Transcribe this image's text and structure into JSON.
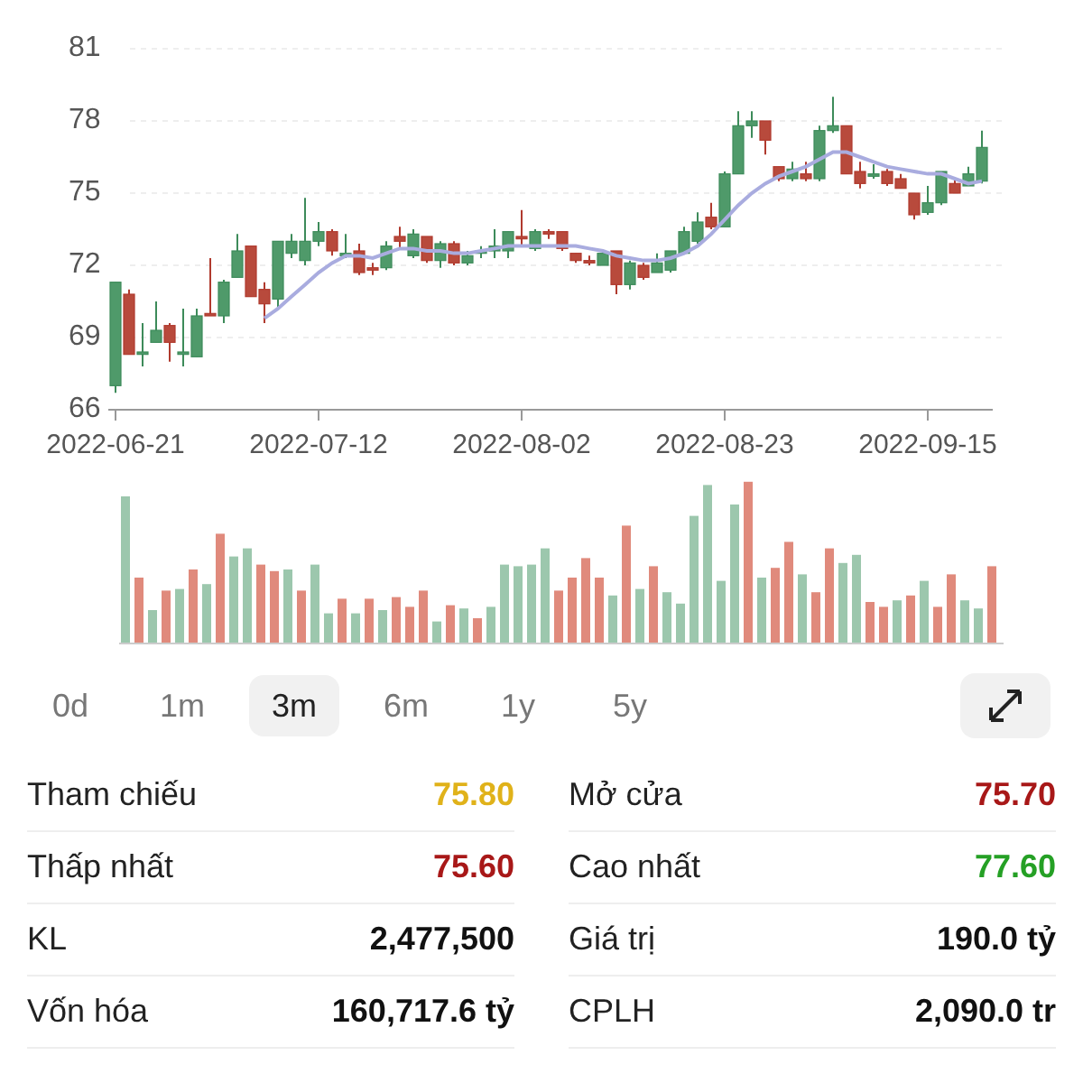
{
  "price_chart": {
    "chart_data": {
      "type": "candlestick",
      "ylim": [
        66,
        81
      ],
      "yticks": [
        81,
        78,
        75,
        72,
        69,
        66
      ],
      "grid": true,
      "categories": [
        "2022-06-21",
        null,
        null,
        null,
        null,
        null,
        null,
        null,
        null,
        null,
        null,
        null,
        null,
        null,
        null,
        "2022-07-12",
        null,
        null,
        null,
        null,
        null,
        null,
        null,
        null,
        null,
        null,
        null,
        null,
        null,
        null,
        "2022-08-02",
        null,
        null,
        null,
        null,
        null,
        null,
        null,
        null,
        null,
        null,
        null,
        null,
        null,
        null,
        "2022-08-23",
        null,
        null,
        null,
        null,
        null,
        null,
        null,
        null,
        null,
        null,
        null,
        null,
        null,
        null,
        "2022-09-15",
        null,
        null,
        null,
        null
      ],
      "ohlc": [
        [
          67,
          71.3,
          66.7,
          71.3
        ],
        [
          70.8,
          71,
          68.3,
          68.3
        ],
        [
          68.3,
          69.6,
          67.8,
          68.4
        ],
        [
          68.8,
          70.5,
          68.8,
          69.3
        ],
        [
          69.5,
          69.6,
          68,
          68.8
        ],
        [
          68.3,
          70.2,
          67.8,
          68.4
        ],
        [
          68.2,
          70.2,
          68.2,
          69.9
        ],
        [
          70,
          72.3,
          69.9,
          69.9
        ],
        [
          69.9,
          71.4,
          69.6,
          71.3
        ],
        [
          71.5,
          73.3,
          71.5,
          72.6
        ],
        [
          72.8,
          72.8,
          70.7,
          70.7
        ],
        [
          71,
          71.3,
          69.6,
          70.4
        ],
        [
          70.6,
          73,
          70.2,
          73
        ],
        [
          72.5,
          73.3,
          72.3,
          73
        ],
        [
          72.2,
          74.8,
          72,
          73
        ],
        [
          73,
          73.8,
          72.8,
          73.4
        ],
        [
          73.4,
          73.5,
          72.4,
          72.6
        ],
        [
          72.4,
          73.3,
          72.3,
          72.5
        ],
        [
          72.6,
          72.9,
          71.6,
          71.7
        ],
        [
          71.9,
          72.1,
          71.6,
          71.8
        ],
        [
          71.9,
          73,
          71.8,
          72.8
        ],
        [
          73.2,
          73.6,
          72.7,
          73
        ],
        [
          72.4,
          73.5,
          72.3,
          73.3
        ],
        [
          73.2,
          73.2,
          72.1,
          72.2
        ],
        [
          72.2,
          73,
          71.9,
          72.9
        ],
        [
          72.9,
          73,
          72,
          72.1
        ],
        [
          72.1,
          72.6,
          72,
          72.4
        ],
        [
          72.5,
          72.8,
          72.3,
          72.6
        ],
        [
          72.6,
          73.5,
          72.3,
          72.8
        ],
        [
          72.6,
          73.4,
          72.3,
          73.4
        ],
        [
          73.2,
          74.3,
          72.8,
          73.1
        ],
        [
          72.7,
          73.5,
          72.6,
          73.4
        ],
        [
          73.4,
          73.5,
          73.1,
          73.3
        ],
        [
          73.4,
          73.4,
          72.6,
          72.7
        ],
        [
          72.5,
          72.5,
          72.1,
          72.2
        ],
        [
          72.2,
          72.4,
          72,
          72.1
        ],
        [
          72,
          72.6,
          72,
          72.5
        ],
        [
          72.6,
          72.6,
          70.8,
          71.2
        ],
        [
          71.2,
          72.2,
          71,
          72.1
        ],
        [
          72,
          72.1,
          71.4,
          71.5
        ],
        [
          71.7,
          72.5,
          71.7,
          72.1
        ],
        [
          71.8,
          72.6,
          71.7,
          72.6
        ],
        [
          72.5,
          73.6,
          72.5,
          73.4
        ],
        [
          73,
          74.2,
          72.9,
          73.8
        ],
        [
          74,
          74.6,
          73.5,
          73.6
        ],
        [
          73.6,
          75.9,
          73.6,
          75.8
        ],
        [
          75.8,
          78.4,
          75.8,
          77.8
        ],
        [
          77.8,
          78.4,
          77.3,
          78
        ],
        [
          78,
          78,
          76.6,
          77.2
        ],
        [
          76.1,
          76.1,
          75.5,
          75.6
        ],
        [
          75.6,
          76.3,
          75.5,
          76
        ],
        [
          75.8,
          76.3,
          75.5,
          75.6
        ],
        [
          75.6,
          77.8,
          75.5,
          77.6
        ],
        [
          77.6,
          79,
          77.5,
          77.8
        ],
        [
          77.8,
          77.8,
          75.8,
          75.8
        ],
        [
          75.9,
          76.3,
          75.2,
          75.4
        ],
        [
          75.7,
          76.2,
          75.6,
          75.8
        ],
        [
          75.9,
          76,
          75.3,
          75.4
        ],
        [
          75.6,
          75.8,
          75.2,
          75.2
        ],
        [
          75,
          75,
          73.9,
          74.1
        ],
        [
          74.2,
          75.3,
          74.1,
          74.6
        ],
        [
          74.6,
          75.9,
          74.5,
          75.9
        ],
        [
          75.4,
          75.6,
          75,
          75
        ],
        [
          75.3,
          76.1,
          75.3,
          75.8
        ],
        [
          75.5,
          77.6,
          75.4,
          76.9
        ]
      ],
      "series": [
        {
          "type": "line",
          "color": "#a9acdf",
          "values": [
            null,
            null,
            null,
            null,
            null,
            null,
            null,
            null,
            null,
            null,
            null,
            69.8,
            70.2,
            70.7,
            71.2,
            71.7,
            72.1,
            72.4,
            72.4,
            72.3,
            72.5,
            72.7,
            72.7,
            72.6,
            72.6,
            72.5,
            72.5,
            72.6,
            72.7,
            72.8,
            72.8,
            72.8,
            72.8,
            72.8,
            72.8,
            72.7,
            72.6,
            72.4,
            72.3,
            72.2,
            72.2,
            72.3,
            72.5,
            72.8,
            73.3,
            73.9,
            74.5,
            75.0,
            75.4,
            75.7,
            75.9,
            76.1,
            76.4,
            76.7,
            76.7,
            76.5,
            76.3,
            76.1,
            76.0,
            75.9,
            75.8,
            75.8,
            75.6,
            75.4,
            75.5
          ]
        }
      ]
    }
  },
  "range_tabs": [
    {
      "label": "0d",
      "selected": false
    },
    {
      "label": "1m",
      "selected": false
    },
    {
      "label": "3m",
      "selected": true
    },
    {
      "label": "6m",
      "selected": false
    },
    {
      "label": "1y",
      "selected": false
    },
    {
      "label": "5y",
      "selected": false
    }
  ],
  "stats": [
    {
      "left": {
        "label": "Tham chiếu",
        "value": "75.80",
        "color": "#e0b21a"
      },
      "right": {
        "label": "Mở cửa",
        "value": "75.70",
        "color": "#a81818"
      }
    },
    {
      "left": {
        "label": "Thấp nhất",
        "value": "75.60",
        "color": "#a81818"
      },
      "right": {
        "label": "Cao nhất",
        "value": "77.60",
        "color": "#25a025"
      }
    },
    {
      "left": {
        "label": "KL",
        "value": "2,477,500",
        "color": "#111111"
      },
      "right": {
        "label": "Giá trị",
        "value": "190.0 tỷ",
        "color": "#111111"
      }
    },
    {
      "left": {
        "label": "Vốn hóa",
        "value": "160,717.6 tỷ",
        "color": "#111111"
      },
      "right": {
        "label": "CPLH",
        "value": "2,090.0 tr",
        "color": "#111111"
      }
    }
  ]
}
